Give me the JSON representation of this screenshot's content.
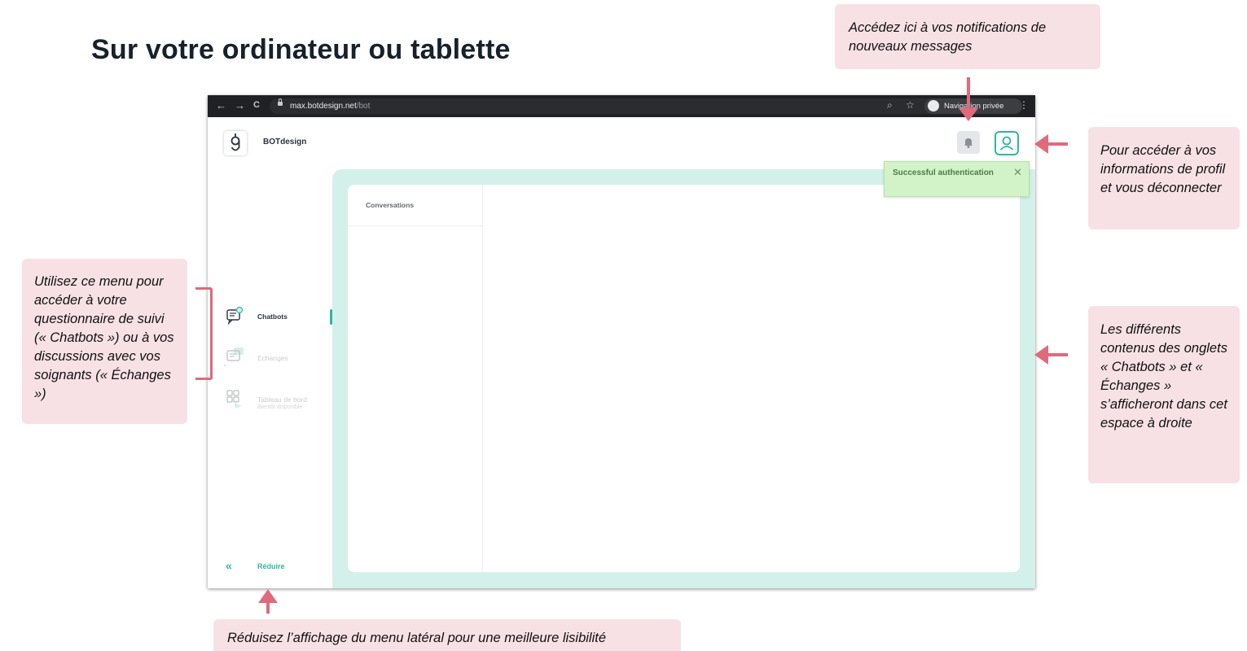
{
  "page_title": "Sur votre ordinateur ou tablette",
  "browser": {
    "back_icon": "←",
    "forward_icon": "→",
    "reload_icon": "C",
    "url_domain": "max.botdesign.net",
    "url_path": "/bot",
    "zoom_icon": "⌕",
    "star_icon": "☆",
    "incognito_label": "Navigation privée",
    "menu_icon": "⋮"
  },
  "app": {
    "brand_name": "BOTdesign",
    "toast_message": "Successful authentication",
    "toast_close": "✕",
    "conversations_header": "Conversations",
    "reduce_icon": "«",
    "reduce_label": "Réduire",
    "sidebar": {
      "items": [
        {
          "label": "Chatbots",
          "sub": "",
          "active": true,
          "icon": "chatbot-icon"
        },
        {
          "label": "Echanges",
          "sub": "",
          "active": false,
          "icon": "chat-icon"
        },
        {
          "label": "Tableau de bord",
          "sub": "Bientôt disponible",
          "active": false,
          "icon": "dashboard-icon"
        }
      ]
    }
  },
  "callouts": {
    "notifications": "Accédez ici à vos notifications de nouveaux messages",
    "profile": "Pour accéder à vos informations de profil et vous déconnecter",
    "menu": "Utilisez ce menu pour accéder à votre questionnaire de suivi (« Chatbots ») ou à vos discussions avec vos soignants (« Échanges »)",
    "content": "Les différents contenus des onglets « Chatbots » et « Échanges » s’afficheront dans cet espace à droite",
    "reduce": "Réduisez l’affichage du menu latéral pour une meilleure lisibilité"
  },
  "colors": {
    "accent": "#2fb6a0",
    "callout_bg": "#f7e1e5",
    "arrow": "#e06a7c",
    "content_bg": "#d4f0eb",
    "toast_bg": "#d2f2c7"
  }
}
